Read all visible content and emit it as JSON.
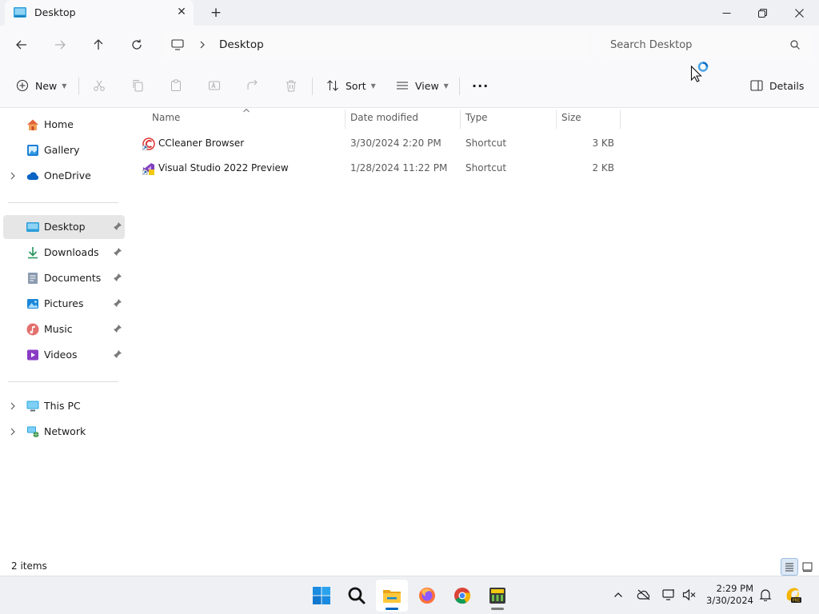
{
  "window": {
    "tab_title": "Desktop",
    "tab_close": "✕",
    "new_tab": "+"
  },
  "address": {
    "breadcrumb": "Desktop",
    "search_placeholder": "Search Desktop"
  },
  "commands": {
    "new_label": "New",
    "sort_label": "Sort",
    "view_label": "View",
    "more_label": "···",
    "details_label": "Details"
  },
  "sidebar": {
    "quick": [
      {
        "label": "Home",
        "icon": "home-icon"
      },
      {
        "label": "Gallery",
        "icon": "gallery-icon"
      },
      {
        "label": "OneDrive",
        "icon": "onedrive-icon"
      }
    ],
    "pinned": [
      {
        "label": "Desktop",
        "icon": "desktop-folder-icon",
        "selected": true
      },
      {
        "label": "Downloads",
        "icon": "downloads-icon"
      },
      {
        "label": "Documents",
        "icon": "documents-icon"
      },
      {
        "label": "Pictures",
        "icon": "pictures-icon"
      },
      {
        "label": "Music",
        "icon": "music-icon"
      },
      {
        "label": "Videos",
        "icon": "videos-icon"
      }
    ],
    "locations": [
      {
        "label": "This PC",
        "icon": "this-pc-icon"
      },
      {
        "label": "Network",
        "icon": "network-icon"
      }
    ]
  },
  "columns": {
    "name": "Name",
    "date": "Date modified",
    "type": "Type",
    "size": "Size"
  },
  "files": [
    {
      "name": "CCleaner Browser",
      "date": "3/30/2024 2:20 PM",
      "type": "Shortcut",
      "size": "3 KB",
      "icon": "ccleaner-browser-icon"
    },
    {
      "name": "Visual Studio 2022 Preview",
      "date": "1/28/2024 11:22 PM",
      "type": "Shortcut",
      "size": "2 KB",
      "icon": "visual-studio-preview-icon"
    }
  ],
  "status": {
    "item_count": "2 items"
  },
  "taskbar": {
    "time": "2:29 PM",
    "date": "3/30/2024",
    "apps": [
      "start-icon",
      "search-icon",
      "file-explorer-icon",
      "firefox-icon",
      "chrome-icon",
      "app-icon"
    ]
  },
  "colors": {
    "accent": "#0067c0",
    "selected_bg": "#e6e6e6",
    "chrome_bg": "#f9f9fb"
  }
}
